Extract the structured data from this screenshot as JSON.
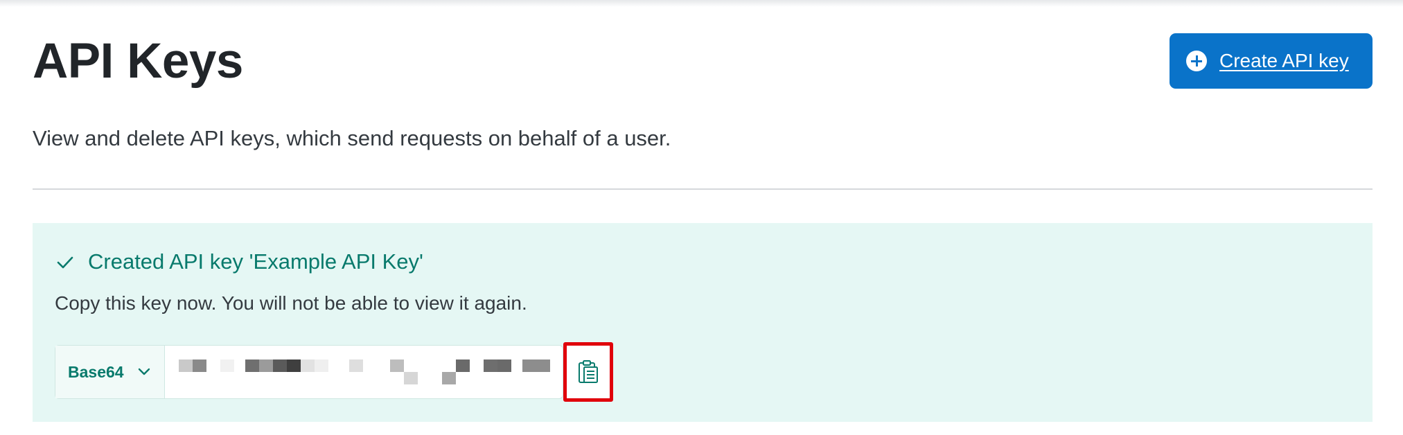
{
  "page": {
    "title": "API Keys",
    "description": "View and delete API keys, which send requests on behalf of a user."
  },
  "create_button": {
    "label": "Create API key",
    "icon": "plus-circle-icon",
    "color": "#0a73c9"
  },
  "success_notice": {
    "title": "Created API key 'Example API Key'",
    "hint": "Copy this key now. You will not be able to view it again.",
    "icon": "check-icon",
    "background": "#e5f7f4",
    "accent": "#087a6c"
  },
  "key_field": {
    "format": "Base64",
    "format_icon": "chevron-down-icon",
    "value_state": "obscured (pixelated)",
    "copy_icon": "clipboard-icon",
    "highlight_color": "#e0000b"
  }
}
